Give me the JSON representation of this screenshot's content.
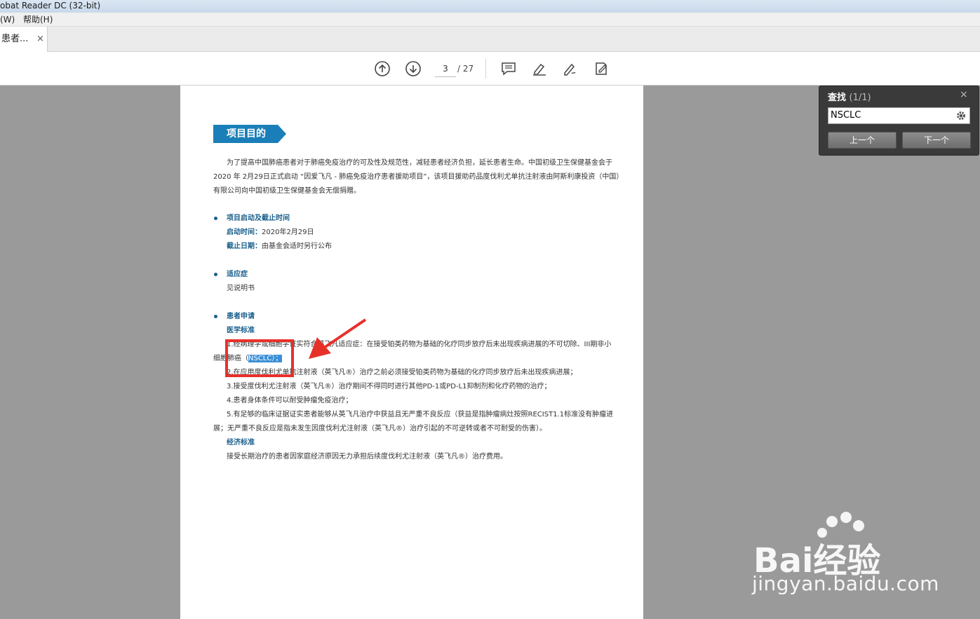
{
  "window": {
    "title": "obat Reader DC (32-bit)"
  },
  "menu": {
    "items": [
      "(W)",
      "帮助(H)"
    ]
  },
  "tab": {
    "label": "患者...",
    "close": "×"
  },
  "toolbar": {
    "page_current": "3",
    "page_total": "/ 27"
  },
  "document": {
    "heading": "项目目的",
    "intro": [
      "为了提高中国肺癌患者对于肺癌免疫治疗的可及性及规范性，减轻患者经济负担，延长患者生命。中国初级卫生保健基金会于",
      "2020 年 2月29日正式启动 “因爱飞凡 - 肺癌免疫治疗患者援助项目”，该项目援助药品度伐利尤单抗注射液由阿斯利康投资（中国）",
      "有限公司向中国初级卫生保健基金会无偿捐赠。"
    ],
    "section1": {
      "title": "项目启动及截止时间",
      "start_label": "启动时间：",
      "start_value": "2020年2月29日",
      "end_label": "截止日期：",
      "end_value": "由基金会适时另行公布"
    },
    "section2": {
      "title": "适应症",
      "body": "见说明书"
    },
    "section3": {
      "title": "患者申请",
      "medical_title": "医学标准",
      "line1": "1.经病理学或细胞学证实符合英飞凡适应症：在接受铂类药物为基础的化疗同步放疗后未出现疾病进展的不可切除、III期非小",
      "line1b_pre": "细胞肺癌（",
      "line1b_hl": "NSCLC）；",
      "line2": "2.在应用度伐利尤单抗注射液（英飞凡®）治疗之前必须接受铂类药物为基础的化疗同步放疗后未出现疾病进展；",
      "line3": "3.接受度伐利尤注射液（英飞凡®）治疗期间不得同时进行其他PD-1或PD-L1抑制剂和化疗药物的治疗；",
      "line4": "4.患者身体条件可以耐受肿瘤免疫治疗；",
      "line5": "5.有足够的临床证据证实患者能够从英飞凡治疗中获益且无严重不良反应（获益是指肿瘤病灶按照RECIST1.1标准没有肿瘤进",
      "line5b": "展；无严重不良反应是指未发生因度伐利尤注射液（英飞凡®）治疗引起的不可逆转或者不可耐受的伤害）。",
      "econ_title": "经济标准",
      "econ_body": "接受长期治疗的患者因家庭经济原因无力承担后续度伐利尤注射液（英飞凡®）治疗费用。"
    }
  },
  "find": {
    "title": "查找",
    "count": "(1/1)",
    "close": "×",
    "query": "NSCLC",
    "prev": "上一个",
    "next": "下一个"
  },
  "watermark": {
    "logo": "Bai经验",
    "url": "jingyan.baidu.com"
  },
  "colors": {
    "accent": "#1a7fb8",
    "annotation": "#e8302b",
    "highlight": "#3b8fd8"
  }
}
